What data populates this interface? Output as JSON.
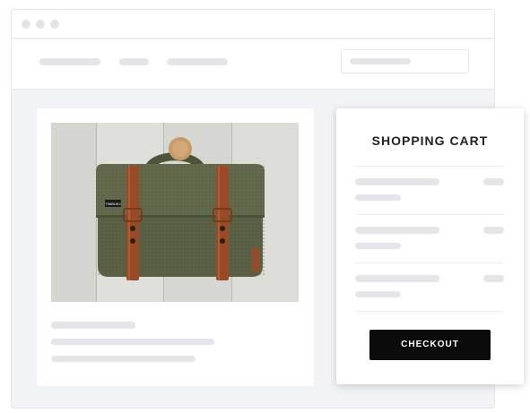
{
  "cart": {
    "title": "SHOPPING CART",
    "checkout_label": "CHECKOUT"
  },
  "product": {
    "image": "green-canvas-messenger-bag",
    "bag_label": "TIMBUK2"
  },
  "colors": {
    "accent": "#0b0b0b",
    "bag": "#5b6145",
    "strap": "#9a4a26",
    "placeholder": "#e3e5e9"
  }
}
